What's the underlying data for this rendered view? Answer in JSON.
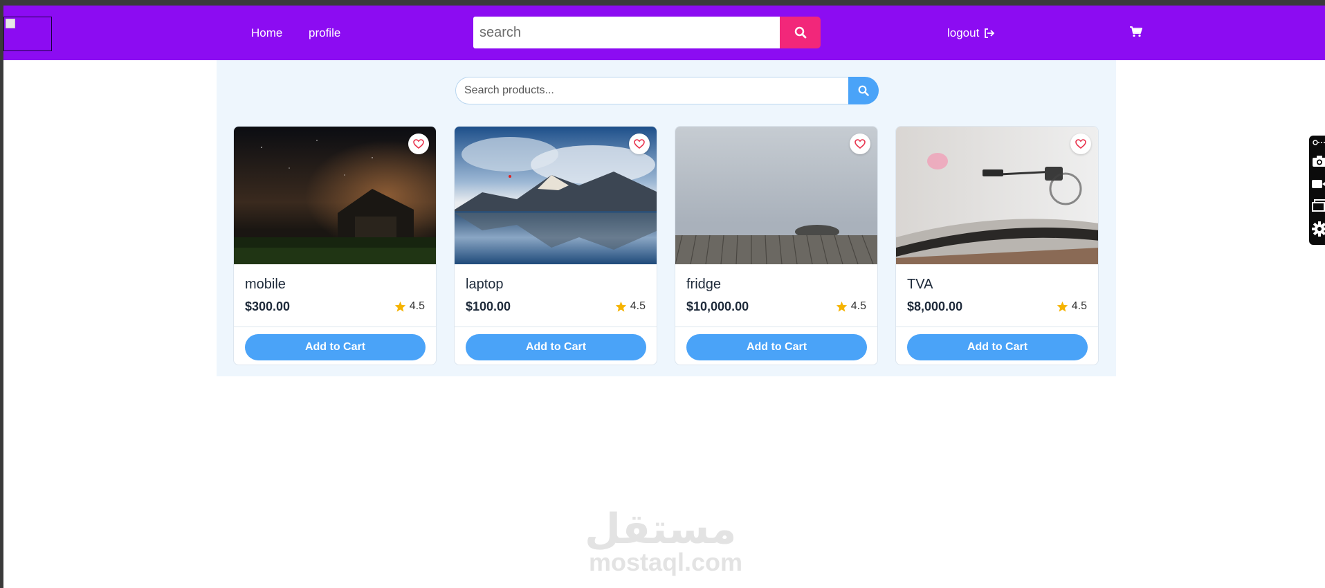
{
  "navbar": {
    "home_label": "Home",
    "profile_label": "profile",
    "search_placeholder": "search",
    "logout_label": "logout",
    "bg_color": "#8c0cf2",
    "search_button_color": "#f2277a"
  },
  "products_panel": {
    "search_placeholder": "Search products...",
    "accent_color": "#4aa3f8",
    "products": [
      {
        "name": "mobile",
        "price": "$300.00",
        "rating": "4.5",
        "button_label": "Add to Cart",
        "image": "night-barn"
      },
      {
        "name": "laptop",
        "price": "$100.00",
        "rating": "4.5",
        "button_label": "Add to Cart",
        "image": "mountain-lake"
      },
      {
        "name": "fridge",
        "price": "$10,000.00",
        "rating": "4.5",
        "button_label": "Add to Cart",
        "image": "foggy-pier"
      },
      {
        "name": "TVA",
        "price": "$8,000.00",
        "rating": "4.5",
        "button_label": "Add to Cart",
        "image": "turntable"
      }
    ]
  },
  "watermark": {
    "arabic": "مستقل",
    "latin": "mostaql.com"
  },
  "icons": {
    "search": "search-icon",
    "logout": "logout-icon",
    "cart": "cart-icon",
    "heart": "heart-icon",
    "star": "star-icon",
    "star_color": "#f5b301"
  }
}
